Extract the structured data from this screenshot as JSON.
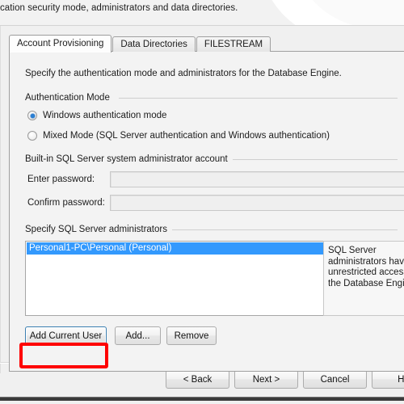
{
  "header": {
    "text": "cation security mode, administrators and data directories."
  },
  "tabs": [
    {
      "label": "Account Provisioning",
      "active": true
    },
    {
      "label": "Data Directories",
      "active": false
    },
    {
      "label": "FILESTREAM",
      "active": false
    }
  ],
  "page": {
    "instruction": "Specify the authentication mode and administrators for the Database Engine."
  },
  "auth_mode": {
    "group_label": "Authentication Mode",
    "options": [
      {
        "label": "Windows authentication mode",
        "selected": true
      },
      {
        "label": "Mixed Mode (SQL Server authentication and Windows authentication)",
        "selected": false
      }
    ]
  },
  "builtin_account": {
    "group_label": "Built-in SQL Server system administrator account",
    "enter_password_label": "Enter password:",
    "enter_password_value": "",
    "confirm_password_label": "Confirm password:",
    "confirm_password_value": ""
  },
  "administrators": {
    "group_label": "Specify SQL Server administrators",
    "items": [
      "Personal1-PC\\Personal (Personal)"
    ],
    "help_text": "SQL Server\nadministrators have\nunrestricted access t\nthe Database Engine",
    "buttons": {
      "add_current_user": "Add Current User",
      "add": "Add...",
      "remove": "Remove"
    }
  },
  "wizard_buttons": {
    "back": "< Back",
    "next": "Next >",
    "cancel": "Cancel",
    "help": "He"
  },
  "annotation": {
    "color": "#fe0000",
    "target": "Add Current User"
  },
  "colors": {
    "selection_blue": "#3399fd",
    "accent_red": "#fe0000",
    "dialog_bg": "#f0f0f0",
    "page_bg": "#f3f3f3"
  }
}
